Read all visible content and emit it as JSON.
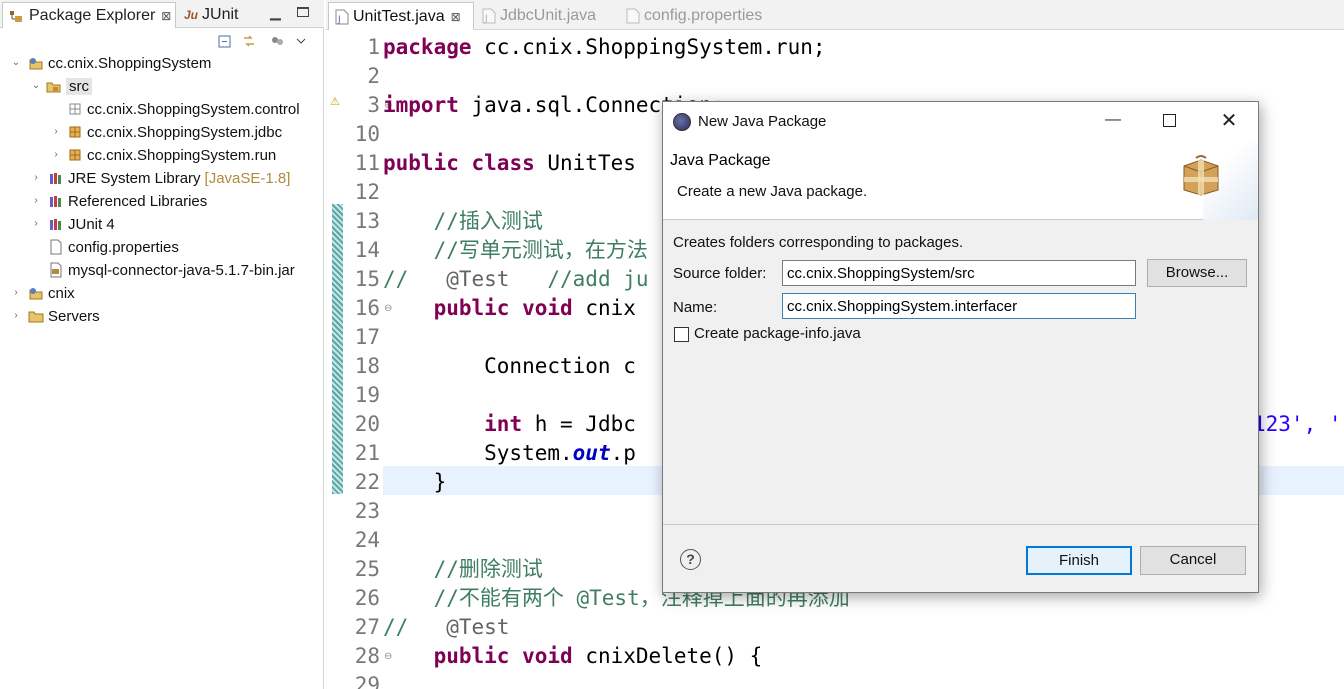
{
  "left_panel": {
    "tabs": [
      {
        "label": "Package Explorer",
        "close": "⊠"
      },
      {
        "label": "JUnit"
      }
    ],
    "tree": [
      {
        "label": "cc.cnix.ShoppingSystem"
      },
      {
        "label": "src"
      },
      {
        "label": "cc.cnix.ShoppingSystem.control"
      },
      {
        "label": "cc.cnix.ShoppingSystem.jdbc"
      },
      {
        "label": "cc.cnix.ShoppingSystem.run"
      },
      {
        "label": "JRE System Library",
        "suffix": "[JavaSE-1.8]"
      },
      {
        "label": "Referenced Libraries"
      },
      {
        "label": "JUnit 4"
      },
      {
        "label": "config.properties"
      },
      {
        "label": "mysql-connector-java-5.1.7-bin.jar"
      },
      {
        "label": "cnix"
      },
      {
        "label": "Servers"
      }
    ]
  },
  "editor": {
    "tabs": [
      {
        "label": "UnitTest.java",
        "close": "⊠"
      },
      {
        "label": "JdbcUnit.java"
      },
      {
        "label": "config.properties"
      }
    ],
    "line_numbers": [
      "1",
      "2",
      "3",
      "10",
      "11",
      "12",
      "13",
      "14",
      "15",
      "16",
      "17",
      "18",
      "19",
      "20",
      "21",
      "22",
      "23",
      "24",
      "25",
      "26",
      "27",
      "28",
      "29"
    ],
    "lines": [
      [
        "package",
        " cc.cnix.ShoppingSystem.run;"
      ],
      [
        ""
      ],
      [
        "import",
        " java.sql.Connection;"
      ],
      [
        ""
      ],
      [
        "public",
        " ",
        "class",
        " UnitTes"
      ],
      [
        ""
      ],
      [
        "    ",
        "//插入测试"
      ],
      [
        "    ",
        "//写单元测试，在方法"
      ],
      [
        "//",
        "   @Test",
        "   //add ju"
      ],
      [
        "    ",
        "public",
        " ",
        "void",
        " cnix"
      ],
      [
        ""
      ],
      [
        "        Connection c"
      ],
      [
        ""
      ],
      [
        "        ",
        "int",
        " h = Jdbc",
        "123', '"
      ],
      [
        "        System.",
        "out",
        ".p"
      ],
      [
        "    }"
      ],
      [
        ""
      ],
      [
        ""
      ],
      [
        "    ",
        "//删除测试"
      ],
      [
        "    ",
        "//不能有两个 @Test，注释掉上面的再添加"
      ],
      [
        "//",
        "   @Test"
      ],
      [
        "    ",
        "public",
        " ",
        "void",
        " cnixDelete() {"
      ],
      [
        ""
      ]
    ]
  },
  "dialog": {
    "title": "New Java Package",
    "heading": "Java Package",
    "subtitle": "Create a new Java package.",
    "description": "Creates folders corresponding to packages.",
    "source_folder_label": "Source folder:",
    "source_folder_value": "cc.cnix.ShoppingSystem/src",
    "browse_label": "Browse...",
    "name_label": "Name:",
    "name_value": "cc.cnix.ShoppingSystem.interfacer",
    "checkbox_label": "Create package-info.java",
    "checkbox_checked": false,
    "help": "?",
    "finish_label": "Finish",
    "cancel_label": "Cancel"
  },
  "colors": {
    "keyword": "#7f0055",
    "comment": "#3f7f5f",
    "string": "#2a00ff",
    "field": "#0000c0",
    "focus_blue": "#0078d7"
  }
}
